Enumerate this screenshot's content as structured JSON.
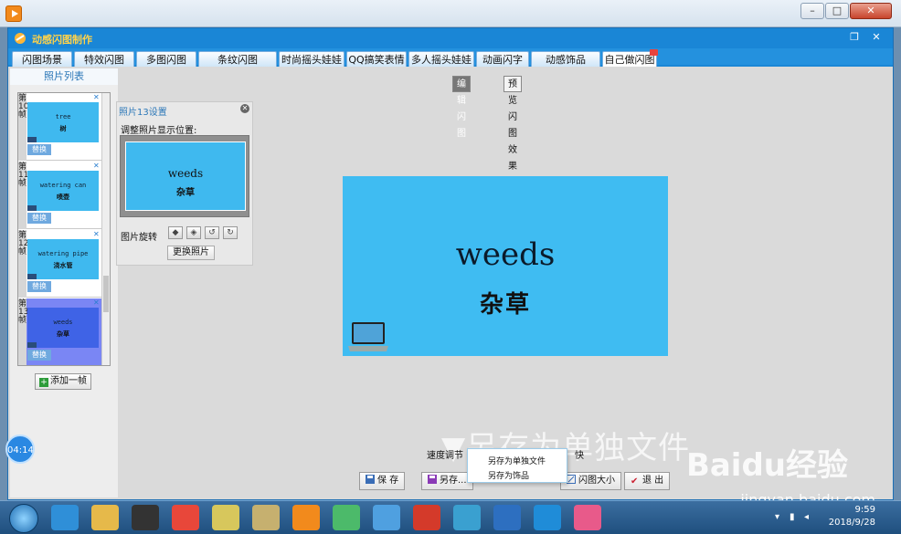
{
  "app": {
    "title": "动感闪图制作",
    "tabs": [
      "闪图场景",
      "特效闪图",
      "多图闪图",
      "条纹闪图",
      "时尚摇头娃娃",
      "QQ搞笑表情",
      "多人摇头娃娃",
      "动画闪字",
      "动感饰品",
      "自己做闪图"
    ],
    "active_tab": "自己做闪图"
  },
  "left_panel": {
    "header": "照片列表",
    "frames": [
      {
        "num": "第\n10\n帧",
        "en": "tree",
        "cn": "树",
        "replace": "替换"
      },
      {
        "num": "第\n11\n帧",
        "en": "watering can",
        "cn": "喷壶",
        "replace": "替换"
      },
      {
        "num": "第\n12\n帧",
        "en": "watering pipe",
        "cn": "浇水管",
        "replace": "替换"
      },
      {
        "num": "第\n13\n帧",
        "en": "weeds",
        "cn": "杂草",
        "replace": "替换"
      }
    ],
    "add_frame": "添加一帧"
  },
  "settings": {
    "title": "照片13设置",
    "position_label": "调整照片显示位置:",
    "preview_en": "weeds",
    "preview_cn": "杂草",
    "rotate_label": "图片旋转",
    "replace_button": "更换照片"
  },
  "modes": {
    "edit": "编辑闪图",
    "preview": "预览闪图效果"
  },
  "canvas": {
    "en": "weeds",
    "cn": "杂草",
    "laptop_text": "电脑人人有"
  },
  "controls": {
    "speed_label": "速度调节",
    "speed_fast": "快",
    "save": "保 存",
    "save_as": "另存...",
    "size": "闪图大小",
    "exit": "退 出"
  },
  "popup": {
    "items": [
      "另存为单独文件",
      "另存为饰品"
    ]
  },
  "caption": "▼另存为单独文件",
  "timer": "04:14",
  "watermark": {
    "brand": "Baidu经验",
    "url": "jingyan.baidu.com"
  },
  "taskbar": {
    "time": "9:59",
    "date": "2018/9/28"
  },
  "colors": {
    "accent": "#1a86d6",
    "canvas": "#3fbcf2",
    "selected_frame": "#7a86f4"
  }
}
